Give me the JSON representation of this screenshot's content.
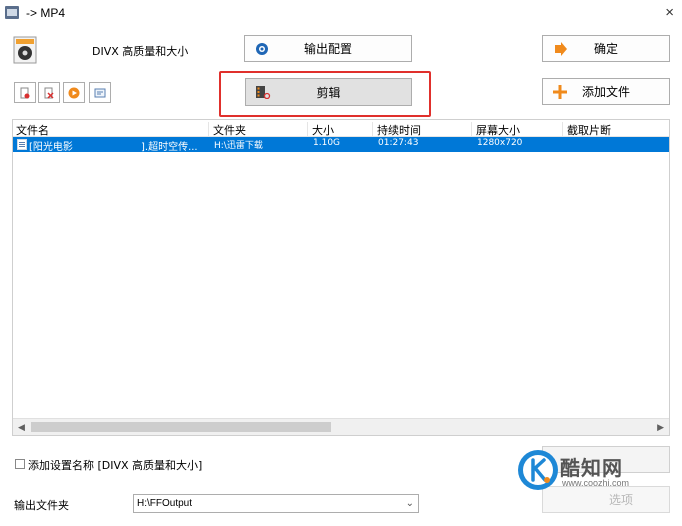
{
  "window": {
    "title": "-> MP4"
  },
  "profile": {
    "label": "DIVX 高质量和大小"
  },
  "buttons": {
    "output_config": "输出配置",
    "ok": "确定",
    "edit": "剪辑",
    "add_file": "添加文件",
    "options_ghost": "选项"
  },
  "toolbar_icons": [
    "remove-file-icon",
    "clear-list-icon",
    "play-icon",
    "media-info-icon"
  ],
  "file_list": {
    "columns": [
      "文件名",
      "文件夹",
      "大小",
      "持续时间",
      "屏幕大小",
      "截取片断"
    ],
    "rows": [
      {
        "name_start": "[阳光电影",
        "name_end": "].超时空传...",
        "folder": "H:\\迅雷下载",
        "size": "1.10G",
        "duration": "01:27:43",
        "screen_size": "1280x720",
        "clip": ""
      }
    ]
  },
  "options": {
    "add_profile_name_label": "添加设置名称 [DIVX 高质量和大小]",
    "add_profile_name_checked": false
  },
  "output": {
    "label": "输出文件夹",
    "folder": "H:\\FFOutput"
  },
  "watermark": {
    "brand": "酷知网",
    "url": "www.coozhi.com"
  },
  "colors": {
    "selection": "#0078d7",
    "highlight_box": "#e0302c",
    "button_face": "#e1e1e1",
    "ok_arrow": "#f08a1c",
    "add_plus": "#f08a1c"
  }
}
